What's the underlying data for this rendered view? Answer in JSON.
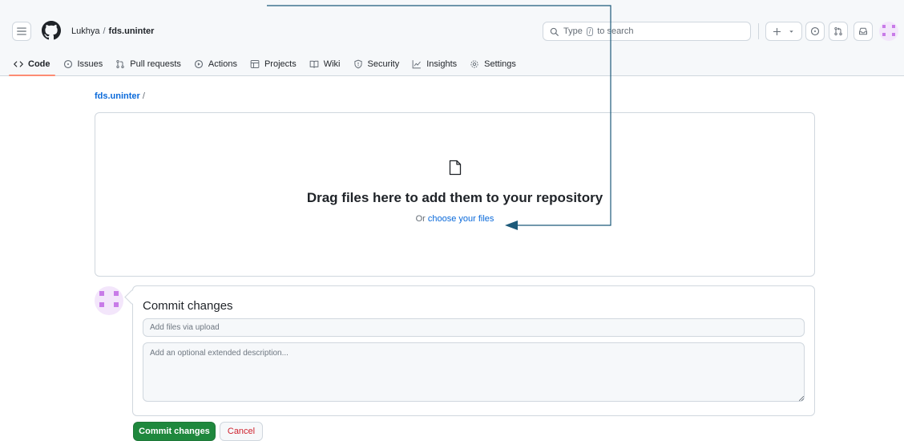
{
  "header": {
    "owner": "Lukhya",
    "separator": "/",
    "repo": "fds.uninter",
    "search": {
      "prefix": "Type",
      "key": "/",
      "suffix": "to search"
    },
    "icons": [
      "hamburger-icon",
      "github-logo-icon",
      "search-icon",
      "plus-icon",
      "triangle-down-icon",
      "issue-opened-icon",
      "pull-request-icon",
      "inbox-icon"
    ]
  },
  "tabs": [
    {
      "label": "Code",
      "icon": "code-icon",
      "active": true
    },
    {
      "label": "Issues",
      "icon": "issue-opened-icon"
    },
    {
      "label": "Pull requests",
      "icon": "pull-request-icon"
    },
    {
      "label": "Actions",
      "icon": "play-icon"
    },
    {
      "label": "Projects",
      "icon": "table-icon"
    },
    {
      "label": "Wiki",
      "icon": "book-icon"
    },
    {
      "label": "Security",
      "icon": "shield-icon"
    },
    {
      "label": "Insights",
      "icon": "graph-icon"
    },
    {
      "label": "Settings",
      "icon": "gear-icon"
    }
  ],
  "breadcrumb": {
    "repo": "fds.uninter",
    "separator": "/"
  },
  "dropzone": {
    "title": "Drag files here to add them to your repository",
    "subtitle_prefix": "Or",
    "link": "choose your files"
  },
  "commit": {
    "title": "Commit changes",
    "summary_placeholder": "Add files via upload",
    "description_placeholder": "Add an optional extended description...",
    "commit_button": "Commit changes",
    "cancel_button": "Cancel"
  },
  "colors": {
    "accent_link": "#0969da",
    "commit_green": "#1f883d",
    "cancel_red": "#cf222e",
    "tab_underline": "#fd8c73",
    "annotation_arrow": "#1d5a7a"
  }
}
